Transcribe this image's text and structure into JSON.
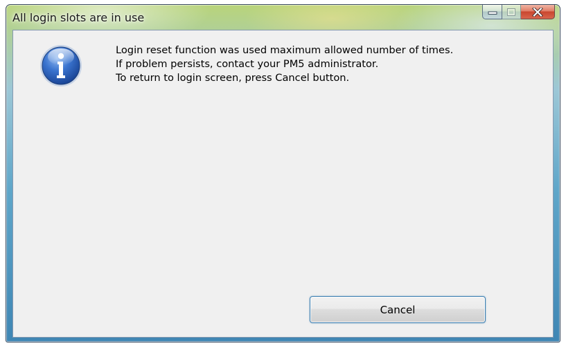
{
  "window": {
    "title": "All login slots are in use"
  },
  "caption_buttons": {
    "minimize_icon": "minimize-icon",
    "maximize_icon": "maximize-icon",
    "close_icon": "close-icon",
    "close_color": "#c9472f"
  },
  "dialog": {
    "icon": "info-icon",
    "icon_color": "#2a5fb8",
    "message_lines": [
      "Login reset function was used maximum allowed number of times.",
      "If problem persists, contact your PM5 administrator.",
      "To return to login screen, press Cancel button."
    ],
    "cancel_label": "Cancel"
  }
}
